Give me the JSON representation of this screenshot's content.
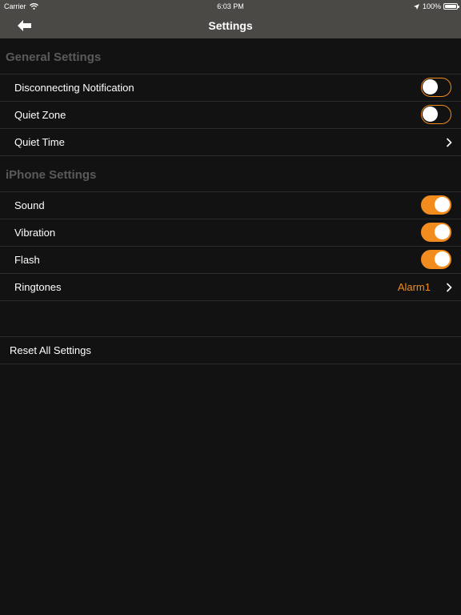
{
  "status_bar": {
    "carrier": "Carrier",
    "time": "6:03 PM",
    "battery_text": "100%",
    "battery_level": 1.0
  },
  "nav": {
    "title": "Settings",
    "back_icon": "back-arrow-icon"
  },
  "sections": {
    "general": {
      "header": "General Settings",
      "rows": {
        "disconnecting": {
          "label": "Disconnecting Notification",
          "on": false
        },
        "quiet_zone": {
          "label": "Quiet Zone",
          "on": false
        },
        "quiet_time": {
          "label": "Quiet Time"
        }
      }
    },
    "iphone": {
      "header": "iPhone Settings",
      "rows": {
        "sound": {
          "label": "Sound",
          "on": true
        },
        "vibration": {
          "label": "Vibration",
          "on": true
        },
        "flash": {
          "label": "Flash",
          "on": true
        },
        "ringtones": {
          "label": "Ringtones",
          "value": "Alarm1"
        }
      }
    }
  },
  "reset": {
    "label": "Reset All Settings"
  },
  "colors": {
    "accent": "#f28c1e",
    "nav_background": "#4b4945",
    "background": "#121212",
    "section_header": "#5a5a5a",
    "separator": "#2c2c2c"
  }
}
